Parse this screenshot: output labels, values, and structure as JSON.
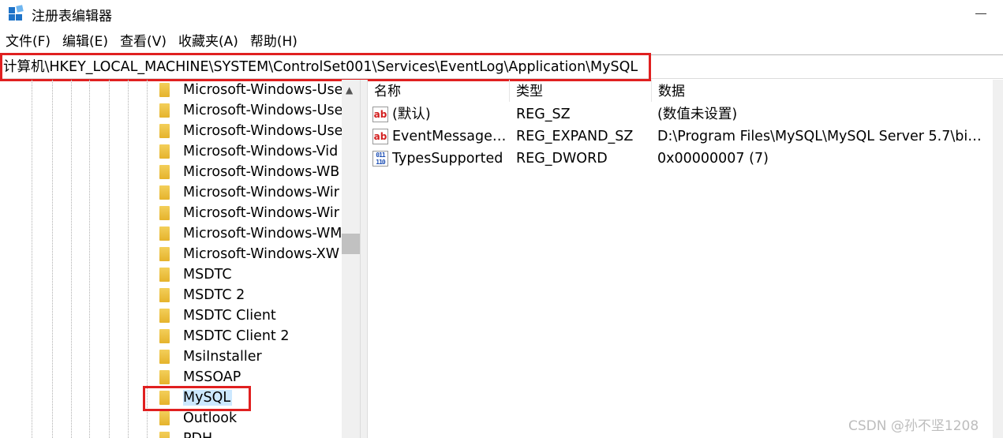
{
  "window": {
    "title": "注册表编辑器",
    "icon": "regedit-icon"
  },
  "menu": [
    "文件(F)",
    "编辑(E)",
    "查看(V)",
    "收藏夹(A)",
    "帮助(H)"
  ],
  "address": "计算机\\HKEY_LOCAL_MACHINE\\SYSTEM\\ControlSet001\\Services\\EventLog\\Application\\MySQL",
  "tree": {
    "items": [
      "Microsoft-Windows-Use",
      "Microsoft-Windows-Use",
      "Microsoft-Windows-Use",
      "Microsoft-Windows-Vid",
      "Microsoft-Windows-WB",
      "Microsoft-Windows-Wir",
      "Microsoft-Windows-Wir",
      "Microsoft-Windows-WM",
      "Microsoft-Windows-XW",
      "MSDTC",
      "MSDTC 2",
      "MSDTC Client",
      "MSDTC Client 2",
      "MsiInstaller",
      "MSSOAP",
      "MySQL",
      "Outlook",
      "PDH"
    ],
    "selected": "MySQL"
  },
  "values": {
    "headers": {
      "name": "名称",
      "type": "类型",
      "data": "数据"
    },
    "rows": [
      {
        "icon": "string-value-icon",
        "name": "(默认)",
        "type": "REG_SZ",
        "data": "(数值未设置)"
      },
      {
        "icon": "string-value-icon",
        "name": "EventMessageF...",
        "type": "REG_EXPAND_SZ",
        "data": "D:\\Program Files\\MySQL\\MySQL Server 5.7\\bin..."
      },
      {
        "icon": "binary-value-icon",
        "name": "TypesSupported",
        "type": "REG_DWORD",
        "data": "0x00000007 (7)"
      }
    ]
  },
  "watermark": "CSDN @孙不坚1208",
  "colors": {
    "highlight_box": "#e02020",
    "selection": "#cce8ff",
    "folder": "#e5b32c"
  }
}
